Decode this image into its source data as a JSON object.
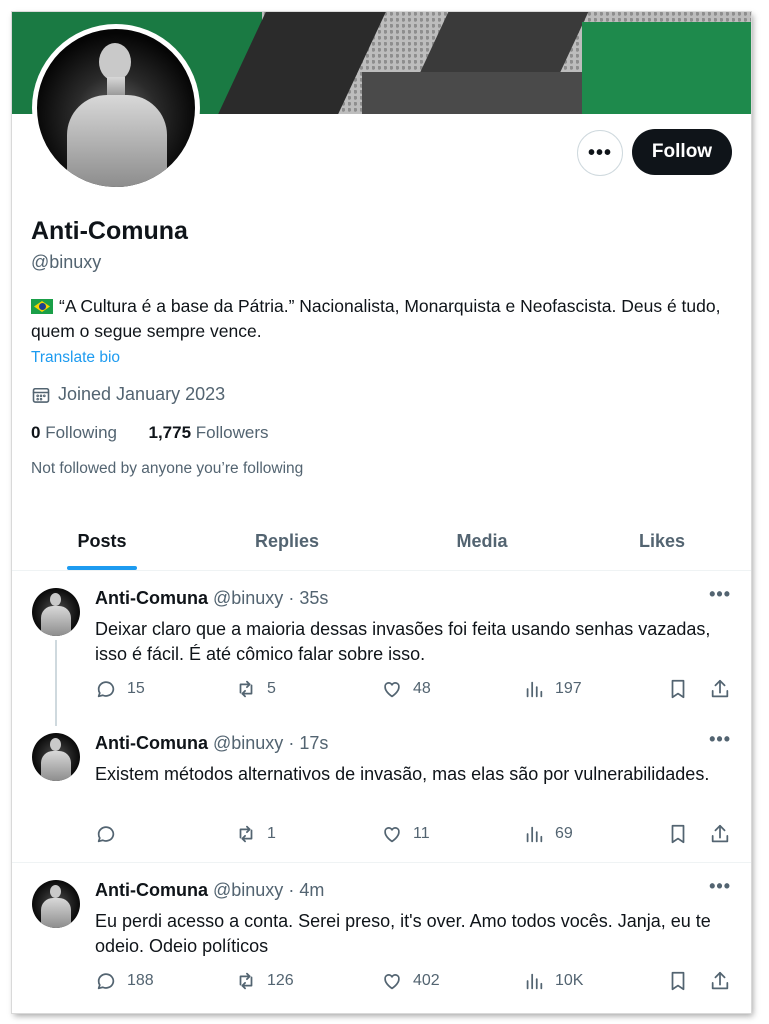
{
  "profile": {
    "display_name": "Anti-Comuna",
    "handle": "@binuxy",
    "bio": "“A Cultura é a base da Pátria.” Nacionalista, Monarquista e Neofascista. Deus é tudo, quem o segue sempre vence.",
    "translate_bio": "Translate bio",
    "joined": "Joined January 2023",
    "following_count": "0",
    "following_label": "Following",
    "followers_count": "1,775",
    "followers_label": "Followers",
    "not_followed": "Not followed by anyone you’re following",
    "follow_button": "Follow",
    "more_button": "•••"
  },
  "tabs": [
    {
      "label": "Posts",
      "active": true
    },
    {
      "label": "Replies",
      "active": false
    },
    {
      "label": "Media",
      "active": false
    },
    {
      "label": "Likes",
      "active": false
    }
  ],
  "posts": [
    {
      "name": "Anti-Comuna",
      "handle": "@binuxy",
      "time": "35s",
      "text": "Deixar claro que a maioria dessas invasões foi feita usando senhas vazadas, isso é fácil. É até cômico falar sobre isso.",
      "replies": "15",
      "reposts": "5",
      "likes": "48",
      "views": "197"
    },
    {
      "name": "Anti-Comuna",
      "handle": "@binuxy",
      "time": "17s",
      "text": "Existem métodos alternativos de invasão, mas elas são por vulnerabilidades.",
      "replies": "",
      "reposts": "1",
      "likes": "11",
      "views": "69"
    },
    {
      "name": "Anti-Comuna",
      "handle": "@binuxy",
      "time": "4m",
      "text": "Eu perdi acesso a conta. Serei preso, it's over. Amo todos vocês. Janja, eu te odeio. Odeio políticos",
      "replies": "188",
      "reposts": "126",
      "likes": "402",
      "views": "10K"
    }
  ],
  "separator": " · ",
  "colors": {
    "accent": "#1d9bf0",
    "text": "#0f1419",
    "muted": "#536471",
    "button": "#0f1419"
  }
}
